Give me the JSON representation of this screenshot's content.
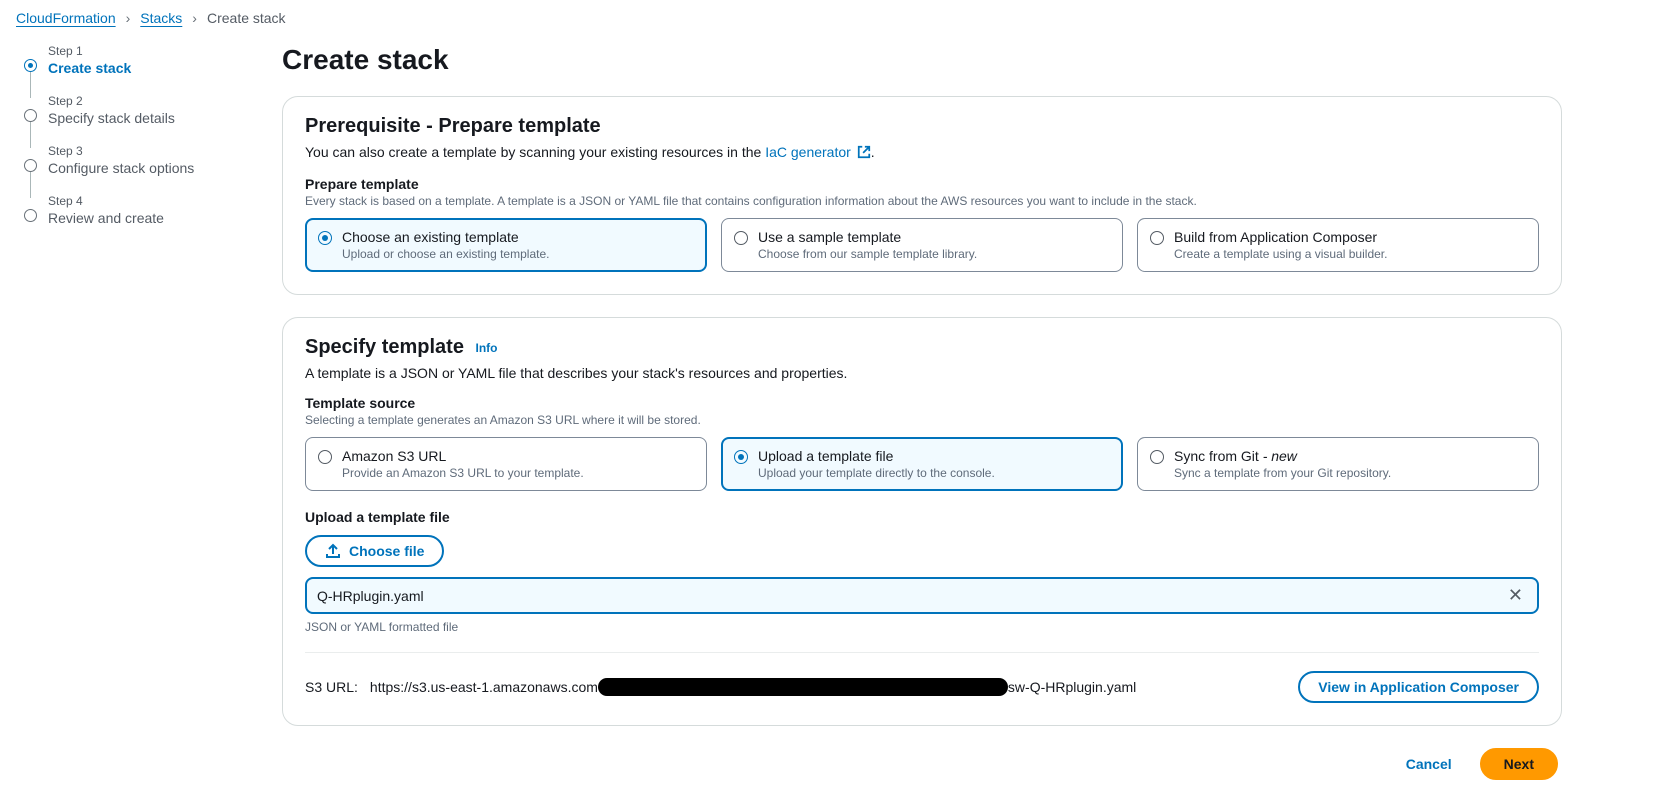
{
  "breadcrumb": {
    "items": [
      "CloudFormation",
      "Stacks"
    ],
    "current": "Create stack"
  },
  "stepper": {
    "steps": [
      {
        "small": "Step 1",
        "main": "Create stack",
        "active": true
      },
      {
        "small": "Step 2",
        "main": "Specify stack details",
        "active": false
      },
      {
        "small": "Step 3",
        "main": "Configure stack options",
        "active": false
      },
      {
        "small": "Step 4",
        "main": "Review and create",
        "active": false
      }
    ]
  },
  "page_title": "Create stack",
  "prereq": {
    "heading": "Prerequisite - Prepare template",
    "subtitle_pre": "You can also create a template by scanning your existing resources in the ",
    "subtitle_link": "IaC generator",
    "subtitle_post": ".",
    "section_label": "Prepare template",
    "section_help": "Every stack is based on a template. A template is a JSON or YAML file that contains configuration information about the AWS resources you want to include in the stack.",
    "options": [
      {
        "title": "Choose an existing template",
        "desc": "Upload or choose an existing template.",
        "selected": true
      },
      {
        "title": "Use a sample template",
        "desc": "Choose from our sample template library.",
        "selected": false
      },
      {
        "title": "Build from Application Composer",
        "desc": "Create a template using a visual builder.",
        "selected": false
      }
    ]
  },
  "specify": {
    "heading": "Specify template",
    "info": "Info",
    "subtitle": "A template is a JSON or YAML file that describes your stack's resources and properties.",
    "section_label": "Template source",
    "section_help": "Selecting a template generates an Amazon S3 URL where it will be stored.",
    "options": [
      {
        "title": "Amazon S3 URL",
        "desc": "Provide an Amazon S3 URL to your template.",
        "selected": false,
        "new": false
      },
      {
        "title": "Upload a template file",
        "desc": "Upload your template directly to the console.",
        "selected": true,
        "new": false
      },
      {
        "title": "Sync from Git",
        "desc": "Sync a template from your Git repository.",
        "selected": false,
        "new": true,
        "new_label": "- new"
      }
    ],
    "upload_label": "Upload a template file",
    "choose_file": "Choose file",
    "filename": "Q-HRplugin.yaml",
    "file_help": "JSON or YAML formatted file",
    "s3_label": "S3 URL:",
    "s3_url_pre": "https://s3.us-east-1.amazonaws.com",
    "s3_url_post": "sw-Q-HRplugin.yaml",
    "view_composer": "View in Application Composer"
  },
  "footer": {
    "cancel": "Cancel",
    "next": "Next"
  }
}
